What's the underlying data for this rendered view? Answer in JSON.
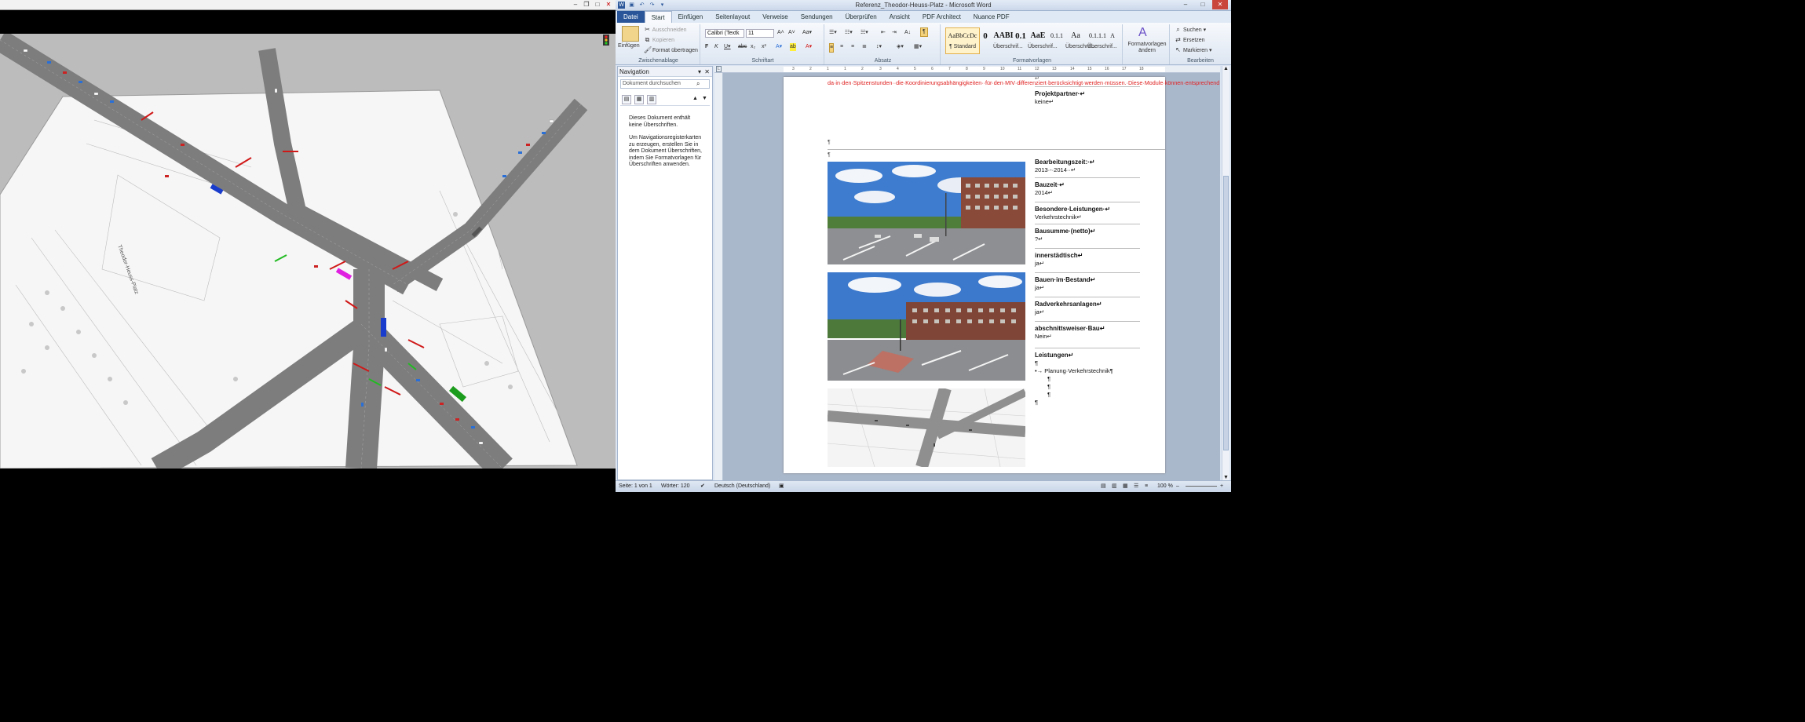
{
  "left_window": {},
  "word": {
    "window_title": "Referenz_Theodor-Heuss-Platz - Microsoft Word",
    "tabs": [
      "Datei",
      "Start",
      "Einfügen",
      "Seitenlayout",
      "Verweise",
      "Sendungen",
      "Überprüfen",
      "Ansicht",
      "PDF Architect",
      "Nuance PDF"
    ],
    "ribbon": {
      "clipboard": {
        "paste": "Einfügen",
        "cut": "Ausschneiden",
        "copy": "Kopieren",
        "format_painter": "Format übertragen",
        "label": "Zwischenablage"
      },
      "font": {
        "name": "Calibri (Textk",
        "size": "11",
        "label": "Schriftart"
      },
      "paragraph": {
        "label": "Absatz"
      },
      "styles": {
        "items": [
          {
            "preview": "AaBbCcDc",
            "label": "¶ Standard"
          },
          {
            "preview": "0",
            "label": "Überschrif..."
          },
          {
            "preview": "AABI",
            "label": "Überschrif..."
          },
          {
            "preview": "0.1",
            "label": "Überschrif..."
          },
          {
            "preview": "AaE",
            "label": "Überschrif..."
          },
          {
            "preview": "0.1.1",
            "label": "Überschrif..."
          },
          {
            "preview": "Aa",
            "label": "Überschrif..."
          },
          {
            "preview": "0.1.1.1",
            "label": "Überschrif..."
          },
          {
            "preview": "A",
            "label": ""
          }
        ],
        "change_styles": "Formatvorlagen ändern",
        "label": "Formatvorlagen"
      },
      "editing": {
        "find": "Suchen",
        "replace": "Ersetzen",
        "select": "Markieren",
        "label": "Bearbeiten"
      }
    },
    "navigation": {
      "title": "Navigation",
      "search_placeholder": "Dokument durchsuchen",
      "msg1": "Dieses Dokument enthält keine Überschriften.",
      "msg2": "Um Navigationsregisterkarten zu erzeugen, erstellen Sie in dem Dokument Überschriften, indem Sie Formatvorlagen für Überschriften anwenden."
    },
    "document": {
      "red_text": "da·in·den·Spitzenstunden··die·Koordinierungsabhängigkeiten··für·den·MIV·differenziert·berücksichtigt·werden·müssen.·Diese·Module·können·entsprechend·hinterlegter·Parameter·aktiviert·bzw.·deaktiviert·werden.·Im·Rahmen·der·Busbeschleunigung·werden·darüber·hinaus·Grenzwerte·für·die·Wartezeiten·des·nichtmotorisierten·Verkehrs·berücksichtigt.¶",
      "pilcrow": "¶",
      "return_mark": "↵",
      "properties": [
        {
          "label": "Projektpartner·↵",
          "value": "keine↵"
        },
        {
          "label": "Bearbeitungszeit:·↵",
          "value": "2013·-·2014··↵"
        },
        {
          "label": "Bauzeit·↵",
          "value": "2014↵"
        },
        {
          "label": "Besondere·Leistungen·↵",
          "value": "Verkehrstechnik↵"
        },
        {
          "label": "Bausumme·(netto)↵",
          "value": "?↵"
        },
        {
          "label": "innerstädtisch↵",
          "value": "ja↵"
        },
        {
          "label": "Bauen·im·Bestand↵",
          "value": "ja↵"
        },
        {
          "label": "Radverkehrsanlagen↵",
          "value": "ja↵"
        },
        {
          "label": "abschnittsweiser·Bau↵",
          "value": "Nein↵"
        }
      ],
      "leistungen_label": "Leistungen↵",
      "leistungen_item": "→ Planung·Verkehrstechnik¶"
    },
    "status": {
      "page": "Seite: 1 von 1",
      "words": "Wörter: 120",
      "language": "Deutsch (Deutschland)",
      "zoom": "100 %"
    },
    "ruler_numbers": [
      "3",
      "2",
      "1",
      "1",
      "2",
      "3",
      "4",
      "5",
      "6",
      "7",
      "8",
      "9",
      "10",
      "11",
      "12",
      "13",
      "14",
      "15",
      "16",
      "17",
      "18"
    ],
    "colors": {
      "file_tab": "#2a5699",
      "red_text": "#e02020"
    }
  }
}
